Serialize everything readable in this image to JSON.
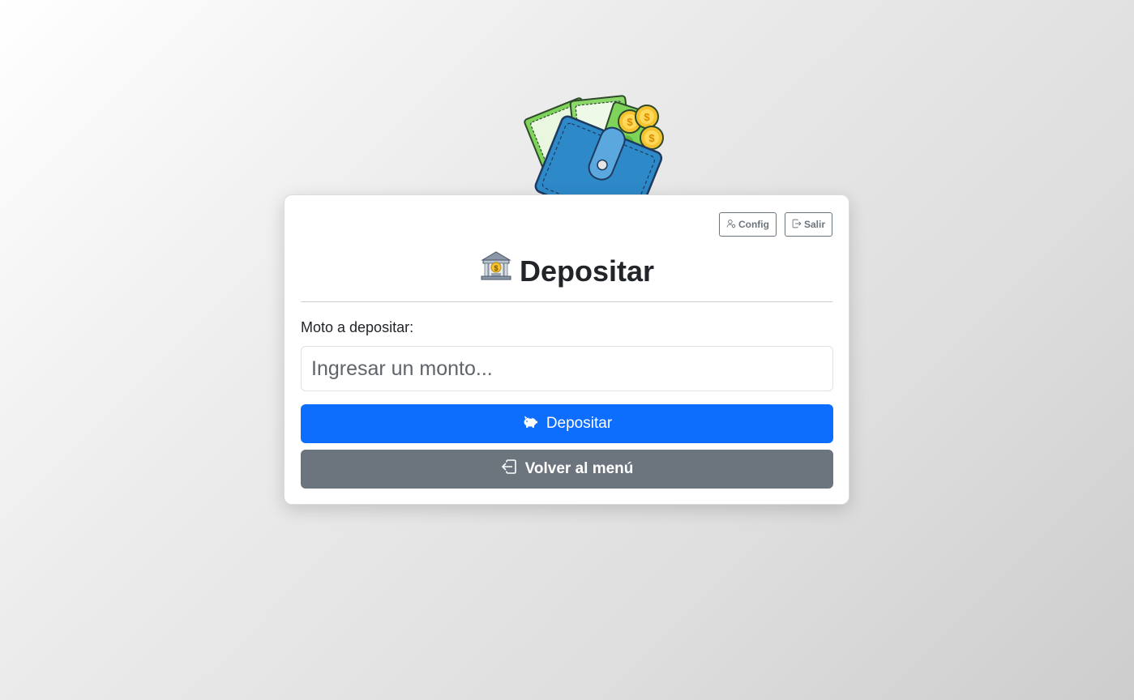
{
  "header": {
    "config_label": "Config",
    "logout_label": "Salir",
    "config_icon": "person-gear-icon",
    "logout_icon": "box-arrow-right-icon"
  },
  "page": {
    "title": "Depositar",
    "title_icon": "bank-icon"
  },
  "form": {
    "amount_label": "Moto a depositar:",
    "amount_value": "",
    "amount_placeholder": "Ingresar un monto...",
    "deposit_label": "Depositar",
    "deposit_icon": "piggy-bank-icon",
    "back_label": "Volver al menú",
    "back_icon": "box-arrow-in-left-icon"
  },
  "colors": {
    "primary": "#0d6efd",
    "secondary": "#6c757d",
    "outline": "#6c757d"
  }
}
